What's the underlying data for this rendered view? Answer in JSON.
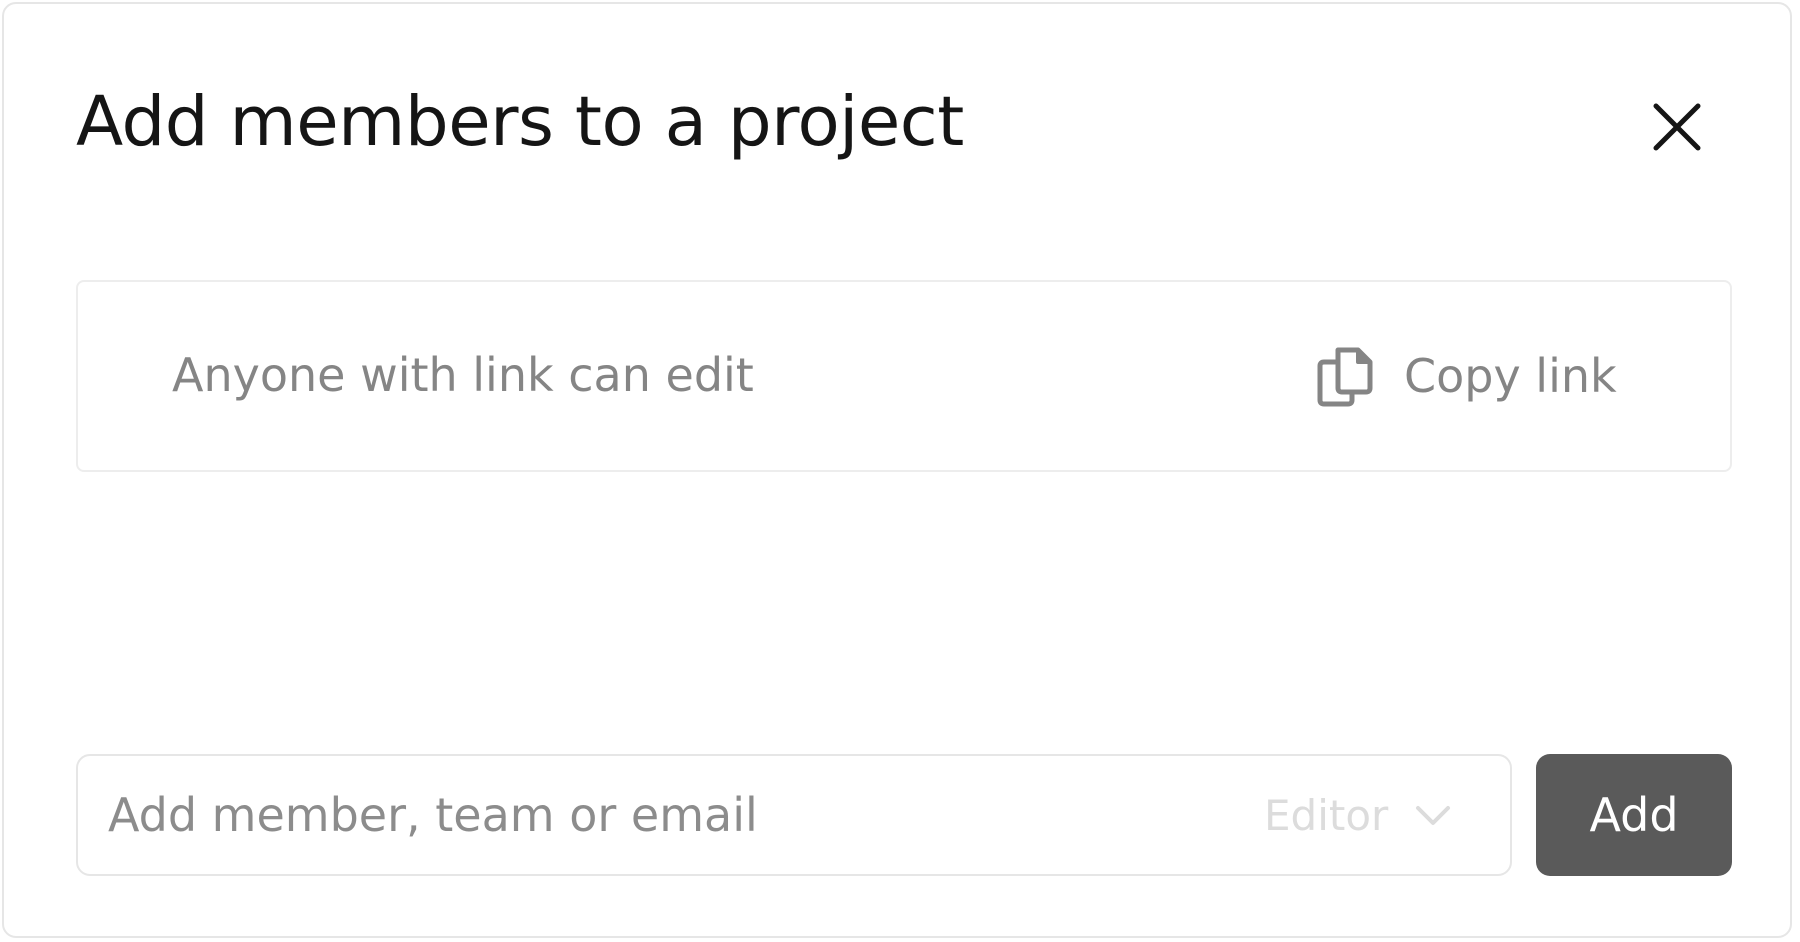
{
  "dialog": {
    "title": "Add members to a project",
    "close_icon": "close-icon"
  },
  "share_link": {
    "permission_text": "Anyone with link can edit",
    "copy_label": "Copy link",
    "copy_icon": "copy-icon"
  },
  "add_member": {
    "input_value": "",
    "input_placeholder": "Add member, team or email",
    "role_selected": "Editor",
    "role_icon": "chevron-down-icon",
    "add_label": "Add"
  },
  "colors": {
    "title": "#151515",
    "muted_text": "#858585",
    "border": "#e6e6e6",
    "button_bg": "#5a5a5a",
    "button_text": "#ffffff",
    "disabled_text": "#dcdcdc"
  }
}
